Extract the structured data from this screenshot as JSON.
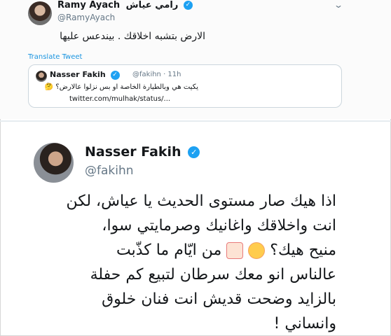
{
  "top_tweet": {
    "name": "Ramy Ayach",
    "name_ar": "رامي عياش",
    "handle": "@RamyAyach",
    "text": "الارض بتشبه اخلاقك . بيندعس عليها",
    "translate_label": "Translate Tweet",
    "quoted": {
      "name": "Nasser Fakih",
      "handle": "@fakihn · 11h",
      "text": "يكيت هي وبالطيارة الخاصة او بس نزلوا عالارض؟ 🤔",
      "link": "twitter.com/mulhak/status/..."
    }
  },
  "main_tweet": {
    "name": "Nasser Fakih",
    "handle": "@fakihn",
    "lines": [
      "اذا هيك صار مستوى الحديث يا عياش، لكن",
      "انت واخلاقك واغانيك وصرمايتي سوا،",
      "منيح هيك؟",
      "من ايّام ما كذّبت",
      "عالناس انو معك سرطان لتبيع كم حفلة",
      "بالزايد وضحت قديش انت فنان خلوق",
      "وانساني !"
    ]
  },
  "icons": {
    "verified": "verified-badge-icon",
    "chevron": "chevron-down-icon",
    "emoji_1": "smiling-face-icon",
    "emoji_2": "person-shrugging-icon"
  },
  "colors": {
    "link": "#1b95e0",
    "verified": "#1da1f2",
    "muted": "#657786"
  }
}
